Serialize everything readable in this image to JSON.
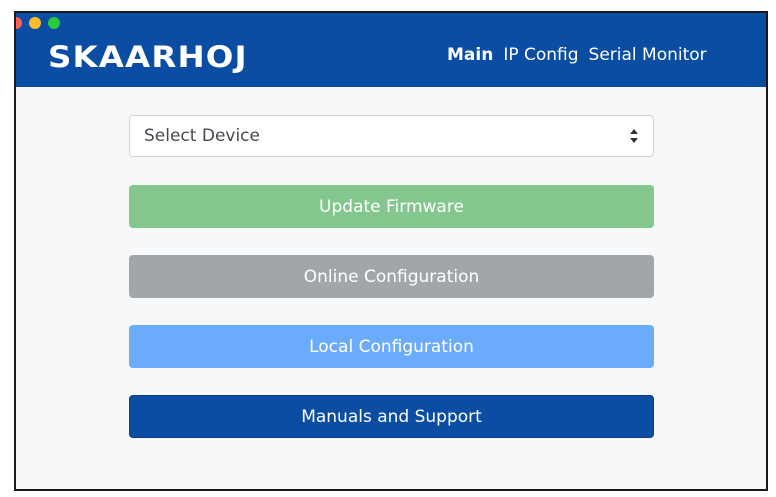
{
  "window": {
    "controls": [
      "close",
      "minimize",
      "zoom"
    ]
  },
  "navbar": {
    "brand": "SKAARHOJ",
    "links": [
      {
        "label": "Main",
        "active": true
      },
      {
        "label": "IP Config",
        "active": false
      },
      {
        "label": "Serial Monitor",
        "active": false
      }
    ]
  },
  "main": {
    "device_select": {
      "value": "Select Device",
      "icon": "sort-arrows-icon"
    },
    "buttons": {
      "update_firmware": "Update Firmware",
      "online_configuration": "Online Configuration",
      "local_configuration": "Local Configuration",
      "manuals_and_support": "Manuals and Support"
    }
  },
  "colors": {
    "navbar": "#0b4da2",
    "firmware_button": "#83c78e",
    "online_button": "#a2a6aa",
    "local_button": "#6aabfb",
    "manuals_button": "#0b4da2"
  }
}
